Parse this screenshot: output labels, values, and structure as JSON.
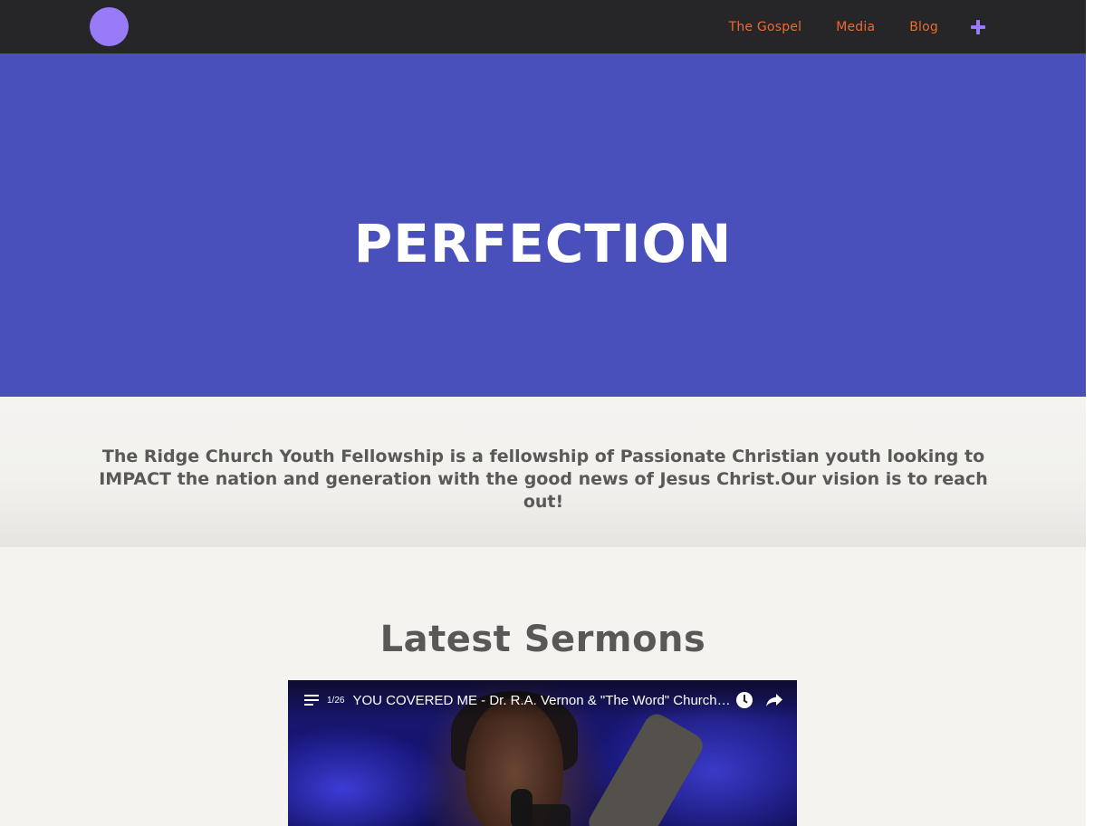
{
  "header": {
    "nav": {
      "gospel": "The Gospel",
      "media": "Media",
      "blog": "Blog"
    },
    "colors": {
      "navbar_bg": "#262528",
      "logo": "#9a7bf7",
      "link": "#ea6a34"
    }
  },
  "hero": {
    "title": "PERFECTION",
    "bg_color": "#4a50bb"
  },
  "intro": {
    "text": "The Ridge Church Youth Fellowship is a fellowship of Passionate Christian youth looking to IMPACT the nation and generation with the good news of Jesus Christ.Our vision is to reach out!"
  },
  "sermons": {
    "heading": "Latest Sermons",
    "video": {
      "playlist_count": "1/26",
      "title": "YOU COVERED ME - Dr. R.A. Vernon & \"The Word\" Church P..."
    }
  },
  "icons": {
    "menu_add": "plus-icon",
    "playlist": "playlist-icon",
    "watch_later": "clock-icon",
    "share": "share-icon"
  }
}
